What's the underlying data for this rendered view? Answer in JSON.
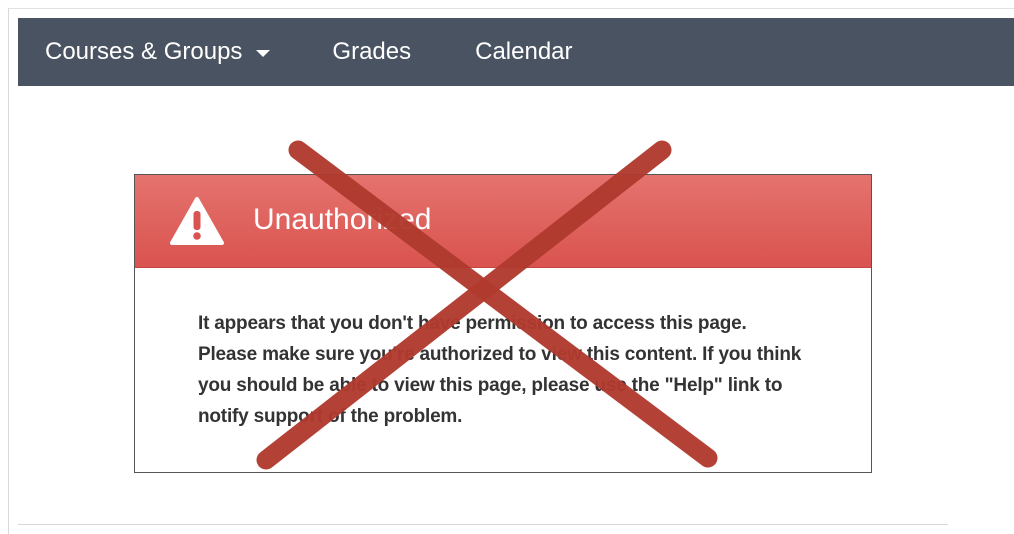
{
  "nav": {
    "courses_label": "Courses & Groups",
    "grades_label": "Grades",
    "calendar_label": "Calendar"
  },
  "alert": {
    "title": "Unauthorized",
    "message": "It appears that you don't have permission to access this page. Please make sure you're authorized to view this content. If you think you should be able to view this page, please use the \"Help\" link to notify support of the problem.",
    "icon": "warning-triangle-icon"
  },
  "overlay": {
    "icon": "cross-out-x-icon",
    "color": "#b03a2e"
  },
  "colors": {
    "navbar": "#4a5361",
    "alert_header": "#d9534f"
  }
}
